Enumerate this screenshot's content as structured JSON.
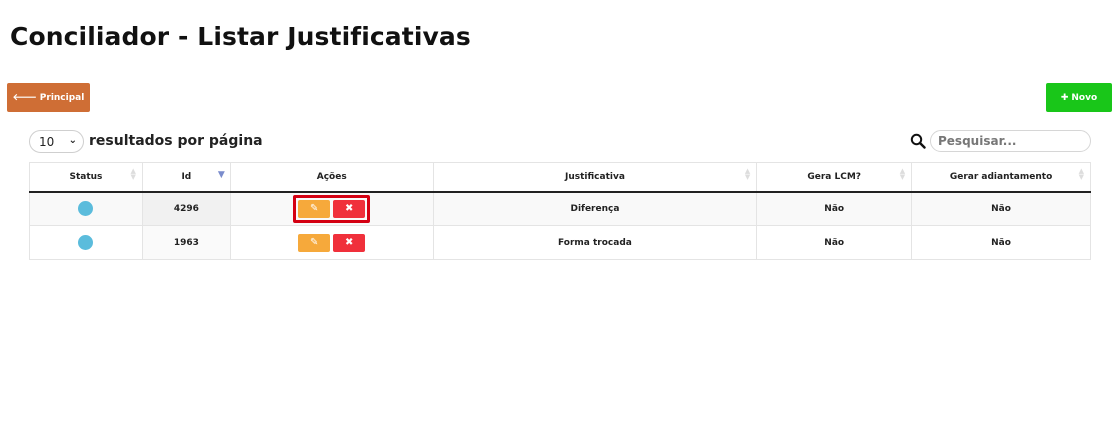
{
  "header": {
    "title": "Conciliador - Listar Justificativas"
  },
  "toolbar": {
    "principal_label": "Principal",
    "novo_label": "Novo"
  },
  "listing": {
    "page_size": "10",
    "page_size_label": "resultados por página",
    "search_placeholder": "Pesquisar..."
  },
  "table": {
    "columns": [
      "Status",
      "Id",
      "Ações",
      "Justificativa",
      "Gera LCM?",
      "Gerar adiantamento"
    ],
    "rows": [
      {
        "status_color": "#5bbcdc",
        "id": "4296",
        "justificativa": "Diferença",
        "gera_lcm": "Não",
        "gerar_adiantamento": "Não",
        "highlighted": true
      },
      {
        "status_color": "#5bbcdc",
        "id": "1963",
        "justificativa": "Forma trocada",
        "gera_lcm": "Não",
        "gerar_adiantamento": "Não",
        "highlighted": false
      }
    ]
  },
  "icons": {
    "principal": "arrow-left-icon",
    "novo": "plus-icon",
    "search": "search-icon",
    "edit": "pencil-icon",
    "delete": "close-icon"
  },
  "colors": {
    "principal_button": "#cf6e35",
    "novo_button": "#19c619",
    "edit_button": "#f6a93b",
    "delete_button": "#f0303b",
    "status_dot": "#5bbcdc",
    "highlight_border": "#d40012"
  }
}
